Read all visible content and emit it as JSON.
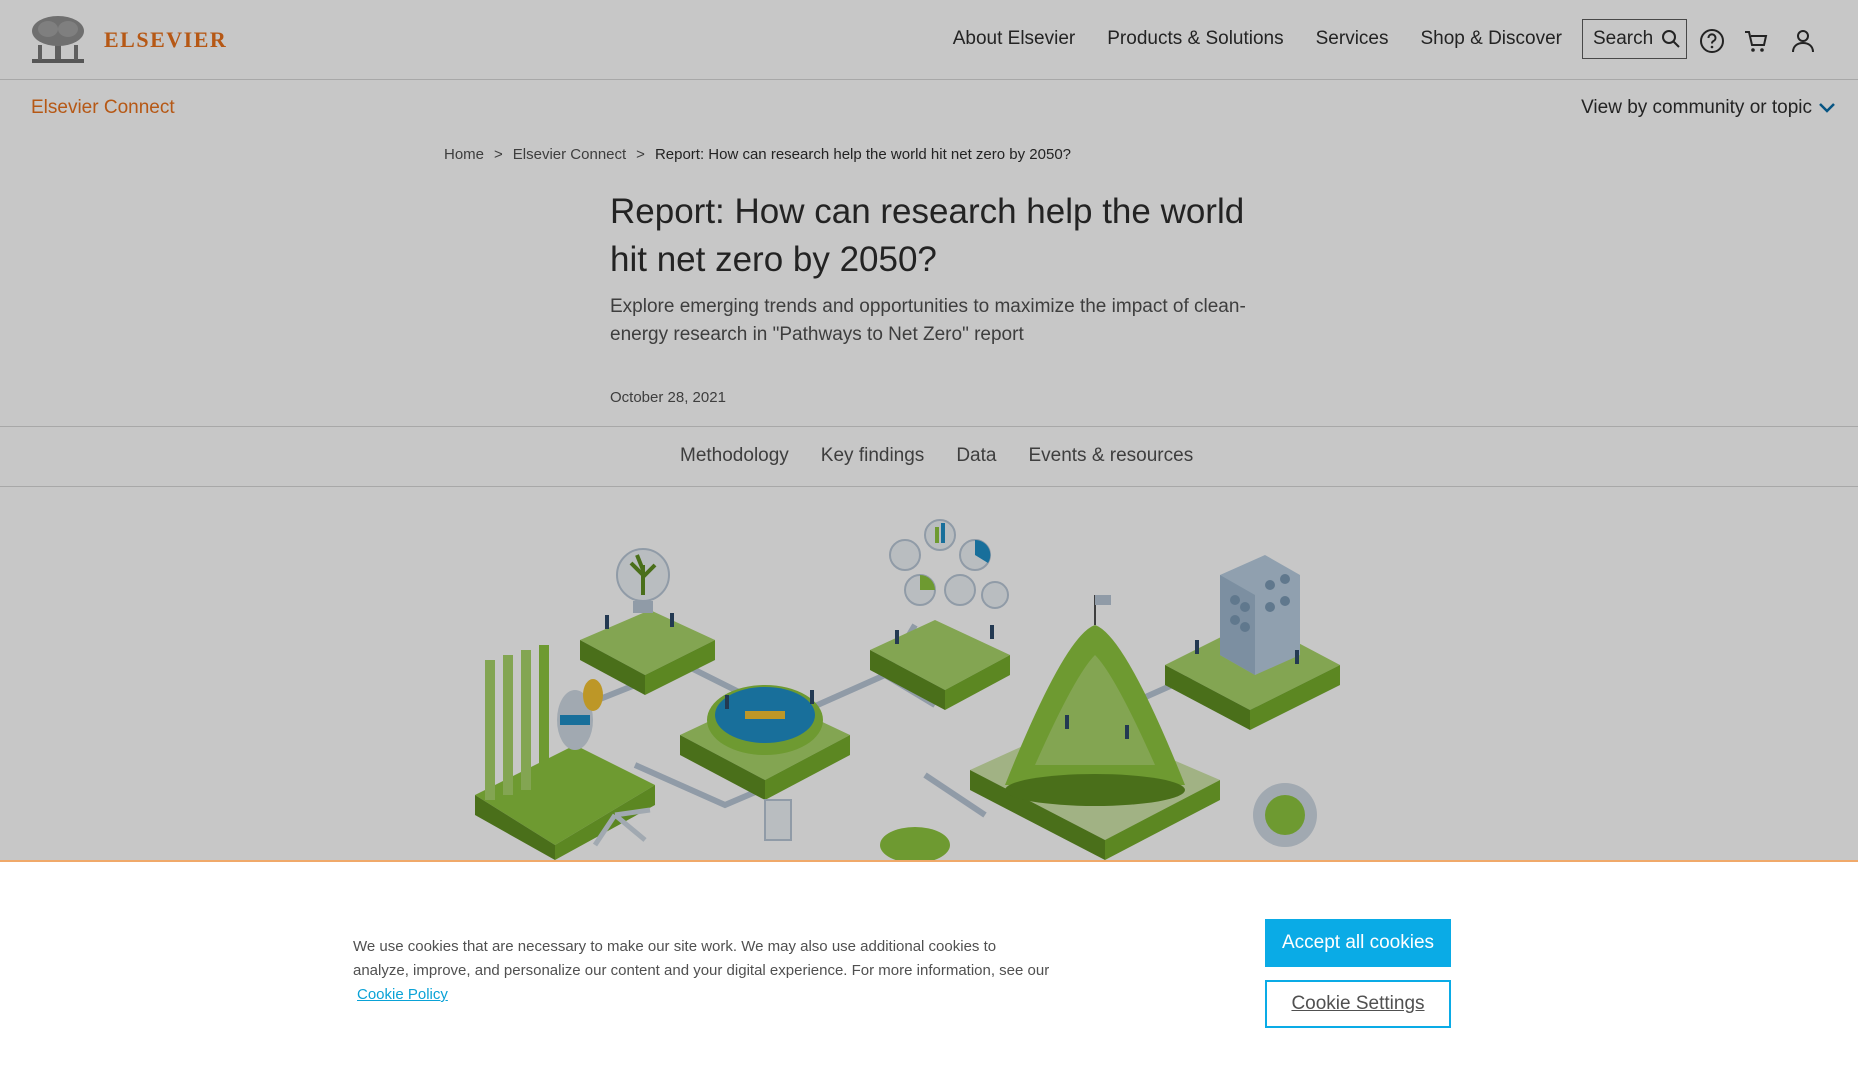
{
  "header": {
    "logo_text": "ELSEVIER",
    "nav": [
      "About Elsevier",
      "Products & Solutions",
      "Services",
      "Shop & Discover"
    ],
    "search_label": "Search",
    "icons": [
      "help-icon",
      "cart-icon",
      "user-icon"
    ]
  },
  "subbar": {
    "section": "Elsevier Connect",
    "view_by": "View by community or topic"
  },
  "breadcrumb": {
    "home": "Home",
    "sep": ">",
    "section": "Elsevier Connect",
    "current": "Report: How can research help the world hit net zero by 2050?"
  },
  "article": {
    "title": "Report: How can research help the world hit net zero by 2050?",
    "subtitle": "Explore emerging trends and opportunities to maximize the impact of clean-energy research in \"Pathways to Net Zero\" report",
    "date": "October 28, 2021"
  },
  "tabs": [
    "Methodology",
    "Key findings",
    "Data",
    "Events & resources"
  ],
  "cookie": {
    "text": "We use cookies that are necessary to make our site work. We may also use additional cookies to analyze, improve, and personalize our content and your digital experience. For more information, see our",
    "link": "Cookie Policy",
    "accept": "Accept all cookies",
    "settings": "Cookie Settings"
  },
  "colors": {
    "brand_orange": "#e9711c",
    "accent_blue": "#0aabe6",
    "illustration_green": "#8dc63f",
    "illustration_blue": "#1f8fc7"
  }
}
